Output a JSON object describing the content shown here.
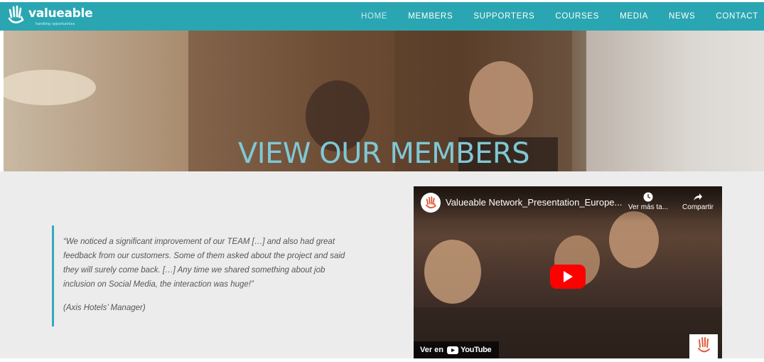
{
  "brand": {
    "name": "valueable",
    "tagline": "handling opportunities",
    "accent_color": "#2aa6b2",
    "icon": "hand-logo-icon"
  },
  "nav": {
    "items": [
      {
        "label": "HOME",
        "active": true
      },
      {
        "label": "MEMBERS",
        "active": false
      },
      {
        "label": "SUPPORTERS",
        "active": false
      },
      {
        "label": "COURSES",
        "active": false
      },
      {
        "label": "MEDIA",
        "active": false
      },
      {
        "label": "NEWS",
        "active": false
      },
      {
        "label": "CONTACT",
        "active": false
      }
    ]
  },
  "hero": {
    "title": "VIEW OUR MEMBERS",
    "title_color": "#7fc8d6"
  },
  "testimonial": {
    "quote": "“We noticed a significant improvement of our TEAM […] and also had great feedback from our customers. Some of them asked about the project and said they will surely come back. […] Any time we shared something about job inclusion on Social Media, the interaction was huge!”",
    "author": "(Axis Hotels’ Manager)",
    "border_color": "#35aabb"
  },
  "video": {
    "title": "Valueable Network_Presentation_Europe...",
    "watch_later_label": "Ver más ta...",
    "share_label": "Compartir",
    "watch_on_label": "Ver en",
    "platform_label": "YouTube",
    "icons": {
      "watch_later": "clock-icon",
      "share": "share-arrow-icon",
      "play": "play-icon",
      "platform": "youtube-logo-icon"
    }
  }
}
